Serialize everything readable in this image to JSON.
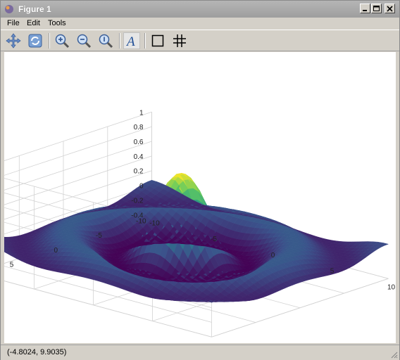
{
  "window": {
    "title": "Figure 1"
  },
  "menu": {
    "file": "File",
    "edit": "Edit",
    "tools": "Tools"
  },
  "toolbar": {
    "icons": [
      "pan-icon",
      "rotate-icon",
      "zoom-in-icon",
      "zoom-out-icon",
      "zoom-reset-icon",
      "text-icon",
      "box-icon",
      "grid-icon"
    ],
    "text_glyph": "A"
  },
  "status": {
    "coordinates": "(-4.8024, 9.9035)"
  },
  "colors": {
    "colormap_low": "#440154",
    "colormap_mid": "#21918c",
    "colormap_high": "#fde725"
  },
  "chart_data": {
    "type": "surface",
    "zlim": [
      -0.4,
      1
    ],
    "xlim": [
      -10,
      10
    ],
    "ylim": [
      -10,
      10
    ],
    "z_ticks": [
      "1",
      "0.8",
      "0.6",
      "0.4",
      "0.2",
      "0",
      "-0.2",
      "-0.4"
    ],
    "x_ticks": [
      "-10",
      "-5",
      "0",
      "5",
      "10"
    ],
    "y_ticks": [
      "-10",
      "-5",
      "0",
      "5",
      "10"
    ],
    "grid": true,
    "colormap": "viridis",
    "peak_z": 1
  }
}
